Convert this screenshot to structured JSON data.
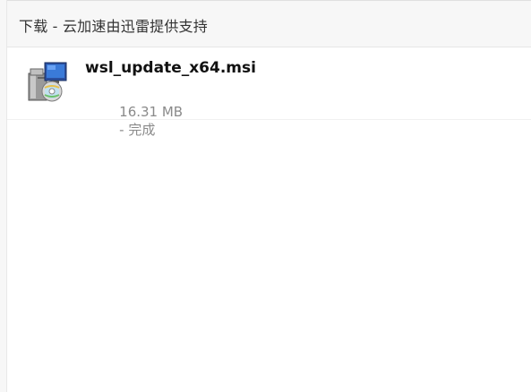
{
  "window": {
    "title": "下载 - 云加速由迅雷提供支持"
  },
  "downloads": [
    {
      "filename": "wsl_update_x64.msi",
      "size": "16.31 MB",
      "status": "- 完成",
      "icon": "msi-installer-icon"
    }
  ]
}
